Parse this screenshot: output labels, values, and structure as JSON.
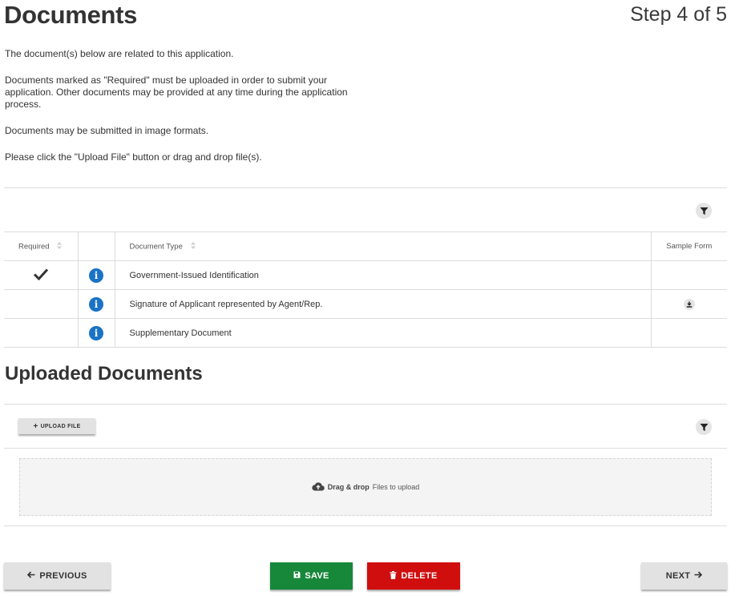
{
  "header": {
    "title": "Documents",
    "step": "Step 4 of 5"
  },
  "intro": {
    "p1": "The document(s) below are related to this application.",
    "p2": "Documents marked as \"Required\" must be uploaded in order to submit your application. Other documents may be provided at any time during the application process.",
    "p3": "Documents may be submitted in image formats.",
    "p4": "Please click the \"Upload File\" button or drag and drop file(s)."
  },
  "table": {
    "columns": {
      "required": "Required",
      "type": "Document Type",
      "sample": "Sample Form"
    },
    "rows": [
      {
        "required": true,
        "type": "Government-Issued Identification",
        "sample": false
      },
      {
        "required": false,
        "type": "Signature of Applicant represented by Agent/Rep.",
        "sample": true
      },
      {
        "required": false,
        "type": "Supplementary Document",
        "sample": false
      }
    ]
  },
  "uploaded": {
    "title": "Uploaded Documents",
    "upload_label": "UPLOAD FILE",
    "drop_bold": "Drag & drop",
    "drop_rest": "Files to upload"
  },
  "footer": {
    "previous": "PREVIOUS",
    "save": "SAVE",
    "delete": "DELETE",
    "next": "NEXT"
  },
  "colors": {
    "save": "#17873a",
    "delete": "#d00e0e",
    "info": "#1a73c4",
    "neutral_button": "#e2e2e2"
  }
}
